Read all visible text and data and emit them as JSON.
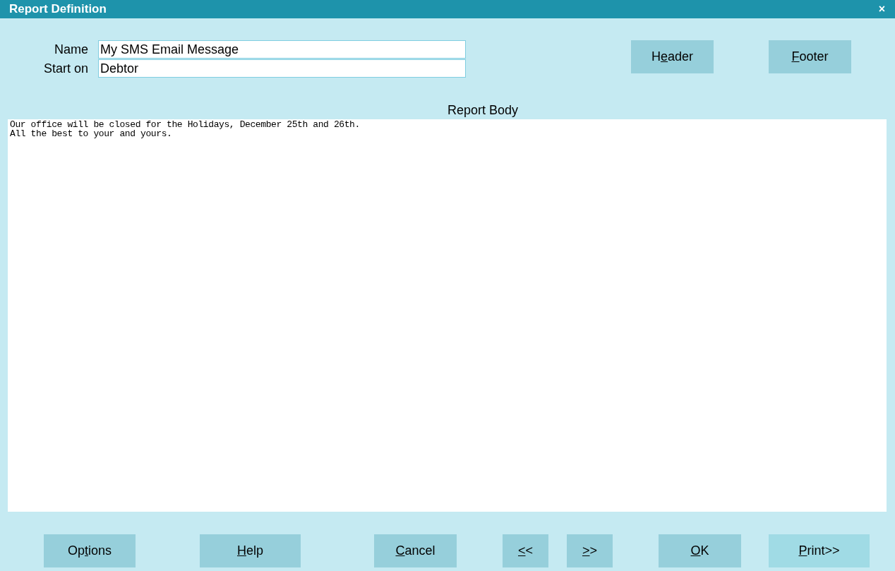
{
  "window": {
    "title": "Report Definition",
    "close": "×"
  },
  "fields": [
    {
      "label": "Name",
      "value": "My SMS Email Message"
    },
    {
      "label": "Start on",
      "value": "Debtor"
    }
  ],
  "top_buttons": [
    {
      "pre": "H",
      "key": "e",
      "post": "ader",
      "focused": false
    },
    {
      "key": "F",
      "post": "ooter",
      "focused": false
    }
  ],
  "report_body": {
    "label": "Report Body",
    "value": "Our office will be closed for the Holidays, December 25th and 26th.\nAll the best to your and yours."
  },
  "bottom_buttons": [
    {
      "pre": "Op",
      "key": "t",
      "post": "ions",
      "focused": false
    },
    {
      "key": "H",
      "post": "elp",
      "focused": false
    },
    {
      "key": "C",
      "post": "ancel",
      "focused": false
    },
    {
      "key": "<",
      "post": "<",
      "focused": false
    },
    {
      "key": ">",
      "post": ">",
      "focused": false
    },
    {
      "key": "O",
      "post": "K",
      "focused": false
    },
    {
      "key": "P",
      "post": "rint>>",
      "focused": true
    }
  ]
}
